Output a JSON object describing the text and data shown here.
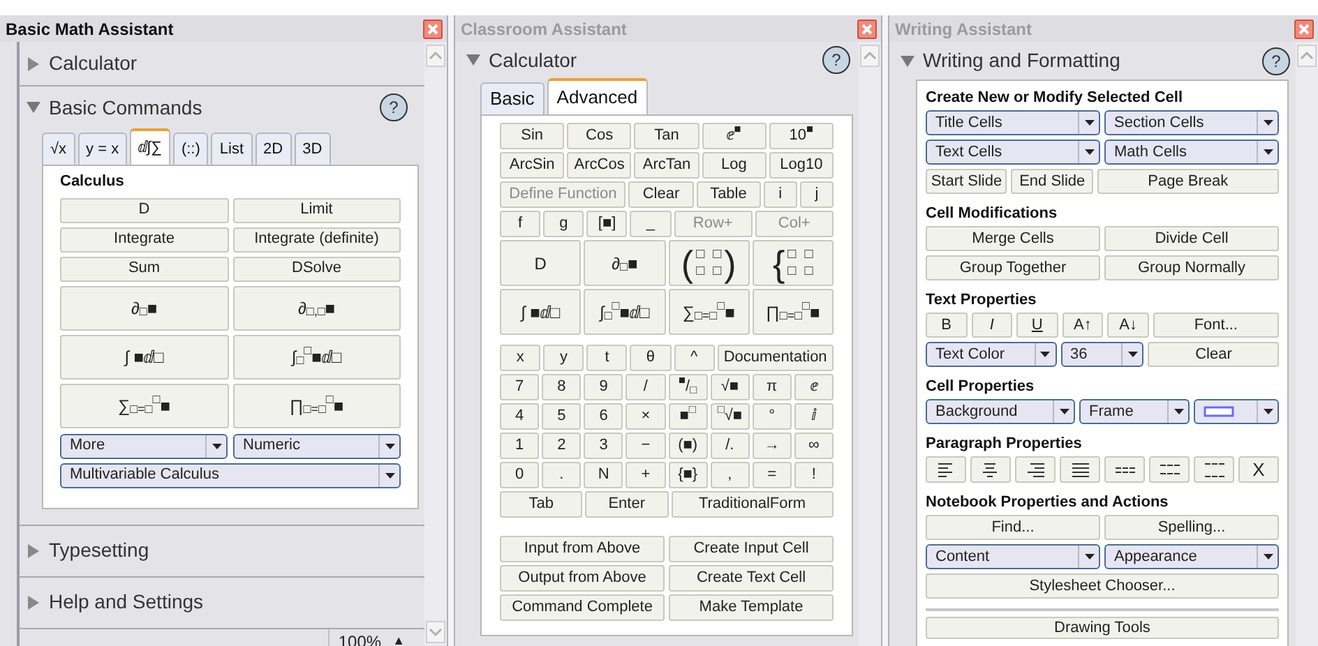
{
  "panels": {
    "basic_math": {
      "title": "Basic Math Assistant",
      "active": true,
      "help": "?",
      "zoom": "100%",
      "zoom_menu": "▲",
      "sections": [
        {
          "label": "Calculator",
          "expanded": false
        },
        {
          "label": "Basic Commands",
          "expanded": true,
          "tabs": [
            {
              "label": "√x",
              "selected": false
            },
            {
              "label": "y = x",
              "selected": false
            },
            {
              "label": "ⅆ∫∑",
              "selected": true
            },
            {
              "label": "(::)",
              "selected": false
            },
            {
              "label": "List",
              "selected": false
            },
            {
              "label": "2D",
              "selected": false
            },
            {
              "label": "3D",
              "selected": false
            }
          ],
          "heading": "Calculus",
          "buttons": [
            {
              "label": "D",
              "kind": "text"
            },
            {
              "label": "Limit",
              "kind": "text"
            },
            {
              "label": "Integrate",
              "kind": "text"
            },
            {
              "label": "Integrate (definite)",
              "kind": "text"
            },
            {
              "label": "Sum",
              "kind": "text"
            },
            {
              "label": "DSolve",
              "kind": "text"
            },
            {
              "label": "∂$_{□}$■",
              "kind": "symbol"
            },
            {
              "label": "∂$_{□,□}$■",
              "kind": "symbol"
            },
            {
              "label": "∫ ■ⅆ□",
              "kind": "symbol"
            },
            {
              "label": "∫$_{□}$$^{□}$■ⅆ□",
              "kind": "symbol"
            },
            {
              "label": "∑$_{□=□}$$^{□}$■",
              "kind": "symbol"
            },
            {
              "label": "∏$_{□=□}$$^{□}$■",
              "kind": "symbol"
            }
          ],
          "dropdowns": [
            {
              "value": "More"
            },
            {
              "value": "Numeric"
            },
            {
              "value": "Multivariable Calculus"
            }
          ]
        },
        {
          "label": "Typesetting",
          "expanded": false
        },
        {
          "label": "Help and Settings",
          "expanded": false
        }
      ]
    },
    "classroom": {
      "title": "Classroom Assistant",
      "active": false,
      "section": "Calculator",
      "expanded": true,
      "help": "?",
      "tabs": [
        {
          "label": "Basic",
          "selected": false
        },
        {
          "label": "Advanced",
          "selected": true
        }
      ],
      "keys": [
        [
          {
            "label": "Sin"
          },
          {
            "label": "Cos"
          },
          {
            "label": "Tan"
          },
          {
            "label": "ⅇ$^{■}$"
          },
          {
            "label": "10$^{■}$"
          }
        ],
        [
          {
            "label": "ArcSin"
          },
          {
            "label": "ArcCos"
          },
          {
            "label": "ArcTan"
          },
          {
            "label": "Log"
          },
          {
            "label": "Log10"
          }
        ],
        [
          {
            "label": "Define Function",
            "disabled": true
          },
          {
            "label": "Clear",
            "disabled": false
          },
          {
            "label": "Table",
            "disabled": false
          },
          {
            "label": "i",
            "disabled": false
          },
          {
            "label": "j",
            "disabled": false
          }
        ],
        [
          {
            "label": "f",
            "disabled": false
          },
          {
            "label": "g",
            "disabled": false
          },
          {
            "label": "[■]",
            "disabled": false
          },
          {
            "label": "_",
            "disabled": false
          },
          {
            "label": "Row+",
            "disabled": true
          },
          {
            "label": "Col+",
            "disabled": true
          }
        ],
        [
          {
            "kind": "text",
            "label": "D"
          },
          {
            "kind": "text",
            "label": "∂$_{□}$■"
          },
          {
            "kind": "matrix",
            "open": "(",
            "close": ")",
            "cells": [
              "□",
              "□",
              "□",
              "□"
            ]
          },
          {
            "kind": "matrix",
            "open": "{",
            "cells": [
              "□",
              "□",
              "□",
              "□"
            ]
          }
        ],
        [
          {
            "kind": "text",
            "label": "∫ ■ⅆ□"
          },
          {
            "kind": "text",
            "label": "∫$_{□}$$^{□}$■ⅆ□"
          },
          {
            "kind": "text",
            "label": "∑$_{□=□}$$^{□}$■"
          },
          {
            "kind": "text",
            "label": "∏$_{□=□}$$^{□}$■"
          }
        ]
      ],
      "keypad": [
        [
          {
            "label": "x"
          },
          {
            "label": "y"
          },
          {
            "label": "t"
          },
          {
            "label": "θ"
          },
          {
            "label": "^"
          },
          {
            "label": "Documentation"
          }
        ],
        [
          {
            "label": "7"
          },
          {
            "label": "8"
          },
          {
            "label": "9"
          },
          {
            "label": "/"
          },
          {
            "label": "$^{■}$/$_{□}$"
          },
          {
            "label": "√■"
          },
          {
            "label": "π"
          },
          {
            "label": "ⅇ"
          }
        ],
        [
          {
            "label": "4"
          },
          {
            "label": "5"
          },
          {
            "label": "6"
          },
          {
            "label": "×"
          },
          {
            "label": "■$^{□}$"
          },
          {
            "label": "$^{□}$√■"
          },
          {
            "label": "°"
          },
          {
            "label": "ⅈ"
          }
        ],
        [
          {
            "label": "1"
          },
          {
            "label": "2"
          },
          {
            "label": "3"
          },
          {
            "label": "−"
          },
          {
            "label": "(■)"
          },
          {
            "label": "/."
          },
          {
            "label": "→"
          },
          {
            "label": "∞"
          }
        ],
        [
          {
            "label": "0"
          },
          {
            "label": "."
          },
          {
            "label": "N"
          },
          {
            "label": "+"
          },
          {
            "label": "{■}"
          },
          {
            "label": ","
          },
          {
            "label": "="
          },
          {
            "label": "!"
          }
        ],
        [
          {
            "label": "Tab"
          },
          {
            "label": "Enter"
          },
          {
            "label": "TraditionalForm"
          }
        ]
      ],
      "actions": [
        [
          {
            "label": "Input from Above"
          },
          {
            "label": "Create Input Cell"
          }
        ],
        [
          {
            "label": "Output from Above"
          },
          {
            "label": "Create Text Cell"
          }
        ],
        [
          {
            "label": "Command Complete"
          },
          {
            "label": "Make Template"
          }
        ]
      ]
    },
    "writing": {
      "title": "Writing Assistant",
      "active": false,
      "section": "Writing and Formatting",
      "expanded": true,
      "help": "?",
      "groups": [
        {
          "heading": "Create New or Modify Selected Cell",
          "rows": [
            {
              "controls": [
                {
                  "kind": "dropdown",
                  "label": "Title Cells"
                },
                {
                  "kind": "dropdown",
                  "label": "Section Cells"
                }
              ]
            },
            {
              "controls": [
                {
                  "kind": "dropdown",
                  "label": "Text Cells"
                },
                {
                  "kind": "dropdown",
                  "label": "Math Cells"
                }
              ]
            },
            {
              "controls": [
                {
                  "kind": "button",
                  "label": "Start Slide"
                },
                {
                  "kind": "button",
                  "label": "End Slide"
                },
                {
                  "kind": "button",
                  "label": "Page Break"
                }
              ]
            }
          ]
        },
        {
          "heading": "Cell Modifications",
          "rows": [
            {
              "controls": [
                {
                  "kind": "button",
                  "label": "Merge Cells"
                },
                {
                  "kind": "button",
                  "label": "Divide Cell"
                }
              ]
            },
            {
              "controls": [
                {
                  "kind": "button",
                  "label": "Group Together"
                },
                {
                  "kind": "button",
                  "label": "Group Normally"
                }
              ]
            }
          ]
        },
        {
          "heading": "Text Properties",
          "rows": [
            {
              "controls": [
                {
                  "kind": "button",
                  "label": "B"
                },
                {
                  "kind": "italic",
                  "label": "I"
                },
                {
                  "kind": "underline",
                  "label": "U"
                },
                {
                  "kind": "button",
                  "label": "A↑"
                },
                {
                  "kind": "button",
                  "label": "A↓"
                },
                {
                  "kind": "button",
                  "label": "Font..."
                }
              ]
            },
            {
              "controls": [
                {
                  "kind": "dropdown",
                  "label": "Text Color"
                },
                {
                  "kind": "dropdown",
                  "label": "36"
                },
                {
                  "kind": "button",
                  "label": "Clear"
                }
              ]
            }
          ]
        },
        {
          "heading": "Cell Properties",
          "rows": [
            {
              "controls": [
                {
                  "kind": "dropdown",
                  "label": "Background"
                },
                {
                  "kind": "dropdown",
                  "label": "Frame"
                },
                {
                  "kind": "swatch"
                }
              ]
            }
          ]
        },
        {
          "heading": "Paragraph Properties",
          "rows": [
            {
              "controls": [
                {
                  "kind": "icon"
                },
                {
                  "kind": "icon"
                },
                {
                  "kind": "icon"
                },
                {
                  "kind": "icon"
                },
                {
                  "kind": "icon"
                },
                {
                  "kind": "icon"
                },
                {
                  "kind": "icon"
                },
                {
                  "kind": "button",
                  "label": "X"
                }
              ]
            }
          ]
        },
        {
          "heading": "Notebook Properties and Actions",
          "rows": [
            {
              "controls": [
                {
                  "kind": "button",
                  "label": "Find..."
                },
                {
                  "kind": "button",
                  "label": "Spelling..."
                }
              ]
            },
            {
              "controls": [
                {
                  "kind": "dropdown",
                  "label": "Content"
                },
                {
                  "kind": "dropdown",
                  "label": "Appearance"
                }
              ]
            },
            {
              "controls": [
                {
                  "kind": "button",
                  "label": "Stylesheet Chooser..."
                }
              ]
            }
          ]
        }
      ],
      "footer": [
        {
          "kind": "button",
          "label": "Drawing Tools"
        }
      ]
    }
  }
}
